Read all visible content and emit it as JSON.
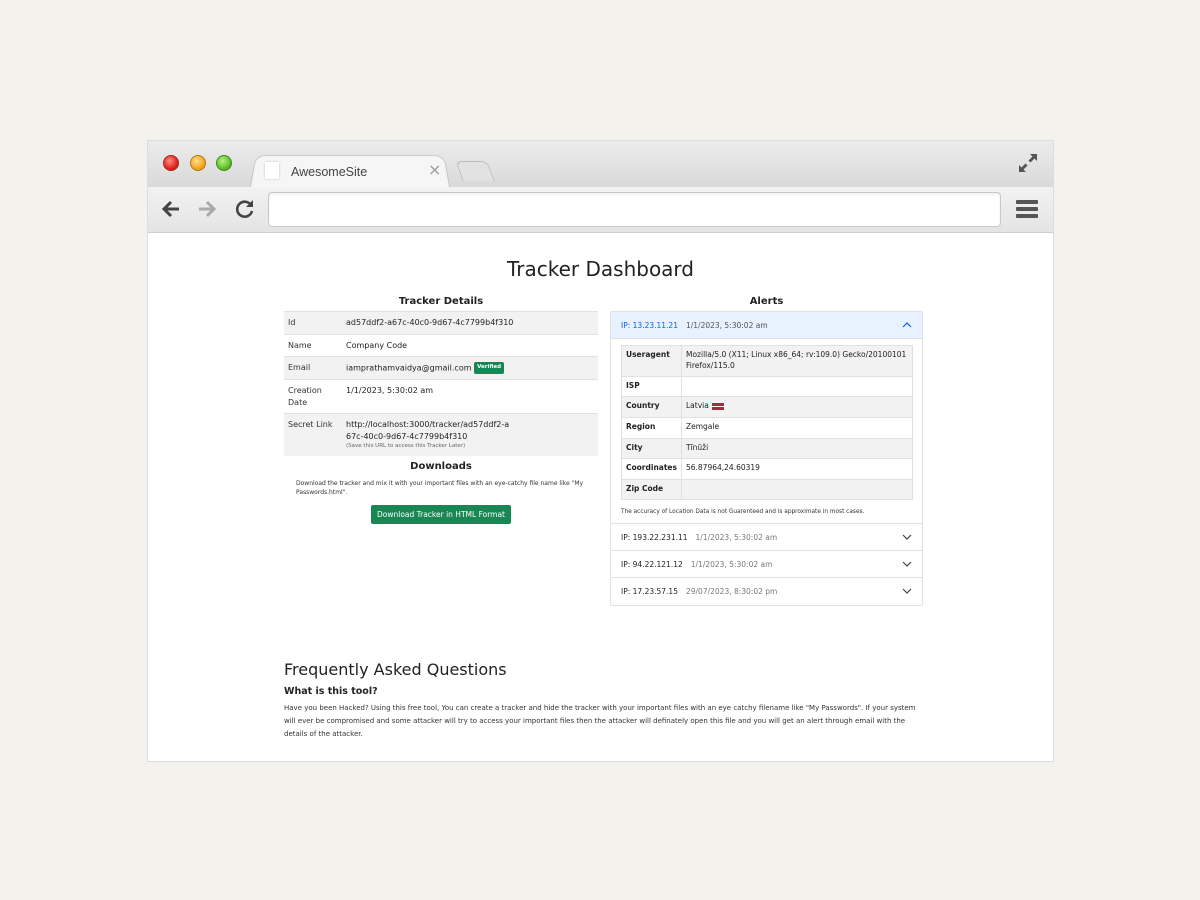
{
  "browser": {
    "tab_title": "AwesomeSite",
    "tab_close": "×",
    "url": ""
  },
  "page": {
    "title": "Tracker Dashboard"
  },
  "tracker_details": {
    "heading": "Tracker Details",
    "rows": [
      {
        "key": "Id",
        "value": "ad57ddf2-a67c-40c0-9d67-4c7799b4f310"
      },
      {
        "key": "Name",
        "value": "Company Code"
      },
      {
        "key": "Email",
        "value": "iamprathamvaidya@gmail.com",
        "badge": "Verified"
      },
      {
        "key": "Creation Date",
        "value": "1/1/2023, 5:30:02 am"
      },
      {
        "key": "Secret Link",
        "value": "http://localhost:3000/tracker/ad57ddf2-a67c-40c0-9d67-4c7799b4f310",
        "note": "(Save this URL to access this Tracker Later)"
      }
    ]
  },
  "downloads": {
    "heading": "Downloads",
    "text": "Download the tracker and mix it with your important files with an eye-catchy file name like \"My Passwords.html\".",
    "button_label": "Download Tracker in HTML Format"
  },
  "alerts": {
    "heading": "Alerts",
    "items": [
      {
        "ip": "IP: 13.23.11.21",
        "time": "1/1/2023, 5:30:02 am",
        "expanded": true
      },
      {
        "ip": "IP: 193.22.231.11",
        "time": "1/1/2023, 5:30:02 am",
        "expanded": false
      },
      {
        "ip": "IP: 94.22.121.12",
        "time": "1/1/2023, 5:30:02 am",
        "expanded": false
      },
      {
        "ip": "IP: 17.23.57.15",
        "time": "29/07/2023, 8:30:02 pm",
        "expanded": false
      }
    ],
    "detail": {
      "rows": [
        {
          "key": "Useragent",
          "value": "Mozilla/5.0 (X11; Linux x86_64; rv:109.0) Gecko/20100101 Firefox/115.0"
        },
        {
          "key": "ISP",
          "value": ""
        },
        {
          "key": "Country",
          "value": "Latvia"
        },
        {
          "key": "Region",
          "value": "Zemgale"
        },
        {
          "key": "City",
          "value": "Tīnūži"
        },
        {
          "key": "Coordinates",
          "value": "56.87964,24.60319"
        },
        {
          "key": "Zip Code",
          "value": ""
        }
      ],
      "note": "The accuracy of Location Data is not Guarenteed and is approximate in most cases."
    }
  },
  "faq": {
    "heading": "Frequently Asked Questions",
    "question": "What is this tool?",
    "answer": "Have you been Hacked? Using this free tool, You can create a tracker and hide the tracker with your important files with an eye catchy filename like \"My Passwords\". If your system will ever be compromised and some attacker will try to access your important files then the attacker will definately open this file and you will get an alert through email with the details of the attacker."
  },
  "colors": {
    "accent_green": "#198754",
    "accordion_open_bg": "#e7f1ff",
    "accordion_open_text": "#0c63e4"
  }
}
